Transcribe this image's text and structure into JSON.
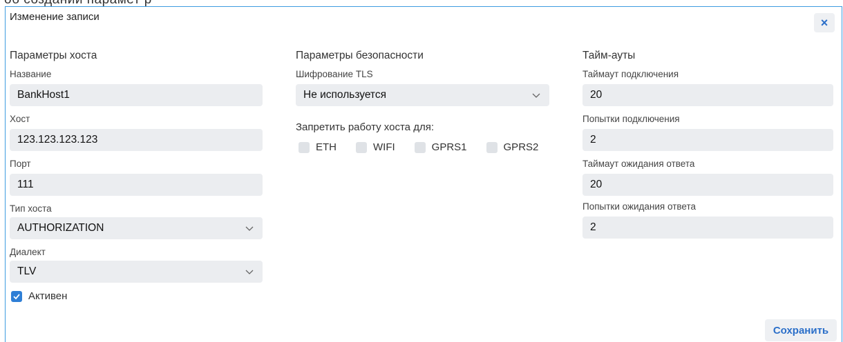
{
  "background_partial_text": "об создании парамет р",
  "dialog": {
    "title": "Изменение записи",
    "close_label": "×",
    "save_label": "Сохранить"
  },
  "host": {
    "section_title": "Параметры хоста",
    "name_label": "Название",
    "name_value": "BankHost1",
    "host_label": "Хост",
    "host_value": "123.123.123.123",
    "port_label": "Порт",
    "port_value": "111",
    "type_label": "Тип хоста",
    "type_value": "AUTHORIZATION",
    "dialect_label": "Диалект",
    "dialect_value": "TLV",
    "active_label": "Активен",
    "active_checked": true
  },
  "security": {
    "section_title": "Параметры безопасности",
    "tls_label": "Шифрование TLS",
    "tls_value": "Не используется",
    "deny_label": "Запретить работу хоста для:",
    "interfaces": [
      {
        "label": "ETH",
        "checked": false
      },
      {
        "label": "WIFI",
        "checked": false
      },
      {
        "label": "GPRS1",
        "checked": false
      },
      {
        "label": "GPRS2",
        "checked": false
      }
    ]
  },
  "timeouts": {
    "section_title": "Тайм-ауты",
    "connect_timeout_label": "Таймаут подключения",
    "connect_timeout_value": "20",
    "connect_attempts_label": "Попытки подключения",
    "connect_attempts_value": "2",
    "response_timeout_label": "Таймаут ожидания ответа",
    "response_timeout_value": "20",
    "response_attempts_label": "Попытки ожидания ответа",
    "response_attempts_value": "2"
  },
  "colors": {
    "accent": "#2b6fc9",
    "border": "#3d9be0",
    "field_bg": "#ebedf0"
  }
}
